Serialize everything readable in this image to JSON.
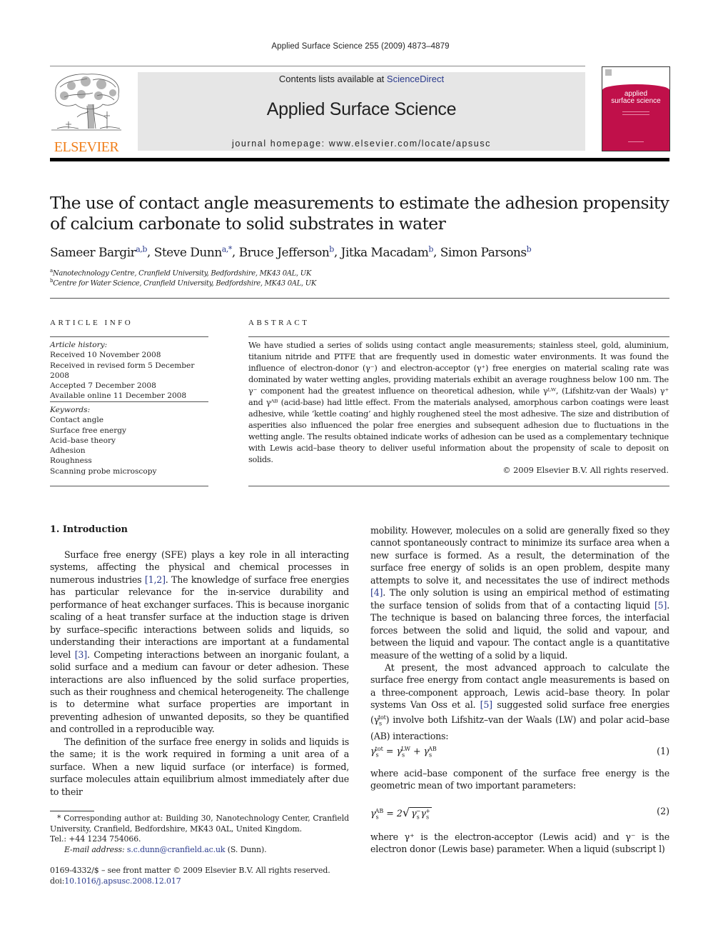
{
  "running_head": "Applied Surface Science 255 (2009) 4873–4879",
  "masthead": {
    "publisher_logo_text": "ELSEVIER",
    "contents_prefix": "Contents lists available at ",
    "contents_link": "ScienceDirect",
    "journal_title": "Applied Surface Science",
    "homepage": "journal homepage: www.elsevier.com/locate/apsusc",
    "cover_title_line1": "applied",
    "cover_title_line2": "surface science",
    "colors": {
      "elsevier_orange": "#f07f1b",
      "cover_red": "#c0104a",
      "link_blue": "#2a3a8c",
      "banner_gray": "#e6e6e6"
    }
  },
  "article": {
    "title": "The use of contact angle measurements to estimate the adhesion propensity of calcium carbonate to solid substrates in water",
    "authors": [
      {
        "name": "Sameer Bargir",
        "sup": "a,b"
      },
      {
        "name": "Steve Dunn",
        "sup": "a,*"
      },
      {
        "name": "Bruce Jefferson",
        "sup": "b"
      },
      {
        "name": "Jitka Macadam",
        "sup": "b"
      },
      {
        "name": "Simon Parsons",
        "sup": "b"
      }
    ],
    "affiliations": [
      {
        "mark": "a",
        "text": "Nanotechnology Centre, Cranfield University, Bedfordshire, MK43 0AL, UK"
      },
      {
        "mark": "b",
        "text": "Centre for Water Science, Cranfield University, Bedfordshire, MK43 0AL, UK"
      }
    ]
  },
  "article_info": {
    "heading": "ARTICLE INFO",
    "history_label": "Article history:",
    "history": [
      "Received 10 November 2008",
      "Received in revised form 5 December 2008",
      "Accepted 7 December 2008",
      "Available online 11 December 2008"
    ],
    "keywords_label": "Keywords:",
    "keywords": [
      "Contact angle",
      "Surface free energy",
      "Acid–base theory",
      "Adhesion",
      "Roughness",
      "Scanning probe microscopy"
    ]
  },
  "abstract": {
    "heading": "ABSTRACT",
    "text": "We have studied a series of solids using contact angle measurements; stainless steel, gold, aluminium, titanium nitride and PTFE that are frequently used in domestic water environments. It was found the influence of electron-donor (γ⁻) and electron-acceptor (γ⁺) free energies on material scaling rate was dominated by water wetting angles, providing materials exhibit an average roughness below 100 nm. The γ⁻ component had the greatest influence on theoretical adhesion, while γᴸᵂ, (Lifshitz-van der Waals) γ⁺ and γᴬᴮ (acid-base) had little effect. From the materials analysed, amorphous carbon coatings were least adhesive, while ‘kettle coating’ and highly roughened steel the most adhesive. The size and distribution of asperities also influenced the polar free energies and subsequent adhesion due to fluctuations in the wetting angle. The results obtained indicate works of adhesion can be used as a complementary technique with Lewis acid–base theory to deliver useful information about the propensity of scale to deposit on solids.",
    "copyright": "© 2009 Elsevier B.V. All rights reserved."
  },
  "body": {
    "section_heading": "1.  Introduction",
    "left_p1_a": "Surface free energy (SFE) plays a key role in all interacting systems, affecting the physical and chemical processes in numerous industries ",
    "left_p1_ref1": "[1,2]",
    "left_p1_b": ". The knowledge of surface free energies has particular relevance for the in-service durability and performance of heat exchanger surfaces. This is because inorganic scaling of a heat transfer surface at the induction stage is driven by surface–specific interactions between solids and liquids, so understanding their interactions are important at a fundamental level ",
    "left_p1_ref2": "[3]",
    "left_p1_c": ". Competing interactions between an inorganic foulant, a solid surface and a medium can favour or deter adhesion. These interactions are also influenced by the solid surface properties, such as their roughness and chemical heterogeneity. The challenge is to determine what surface properties are important in preventing adhesion of unwanted deposits, so they be quantified and controlled in a reproducible way.",
    "left_p2": "The definition of the surface free energy in solids and liquids is the same; it is the work required in forming a unit area of a surface. When a new liquid surface (or interface) is formed, surface molecules attain equilibrium almost immediately after due to their",
    "right_p1_a": "mobility. However, molecules on a solid are generally fixed so they cannot spontaneously contract to minimize its surface area when a new surface is formed. As a result, the determination of the surface free energy of solids is an open problem, despite many attempts to solve it, and necessitates the use of indirect methods ",
    "right_p1_ref1": "[4]",
    "right_p1_b": ". The only solution is using an empirical method of estimating the surface tension of solids from that of a contacting liquid ",
    "right_p1_ref2": "[5]",
    "right_p1_c": ". The technique is based on balancing three forces, the interfacial forces between the solid and liquid, the solid and vapour, and between the liquid and vapour. The contact angle is a quantitative measure of the wetting of a solid by a liquid.",
    "right_p2_a": "At present, the most advanced approach to calculate the surface free energy from contact angle measurements is based on a three-component approach, Lewis acid–base theory. In polar systems Van Oss et al. ",
    "right_p2_ref": "[5]",
    "right_p2_b": " suggested solid surface free energies (γ",
    "right_p2_c": ") involve both Lifshitz–van der Waals (LW) and polar acid–base (AB) interactions:",
    "eq1_number": "(1)",
    "between_eq": "where acid–base component of the surface free energy is the geometric mean of two important parameters:",
    "eq2_number": "(2)",
    "after_eq2": "where γ⁺ is the electron-acceptor (Lewis acid) and γ⁻ is the electron donor (Lewis base) parameter. When a liquid (subscript l)"
  },
  "footnotes": {
    "corresponding": "* Corresponding author at: Building 30, Nanotechnology Center, Cranfield University, Cranfield, Bedfordshire, MK43 0AL, United Kingdom.",
    "tel": "Tel.: +44 1234 754066.",
    "email_label": "E-mail address: ",
    "email": "s.c.dunn@cranfield.ac.uk",
    "email_suffix": " (S. Dunn).",
    "front_matter": "0169-4332/$ – see front matter © 2009 Elsevier B.V. All rights reserved.",
    "doi_prefix": "doi:",
    "doi": "10.1016/j.apsusc.2008.12.017"
  }
}
